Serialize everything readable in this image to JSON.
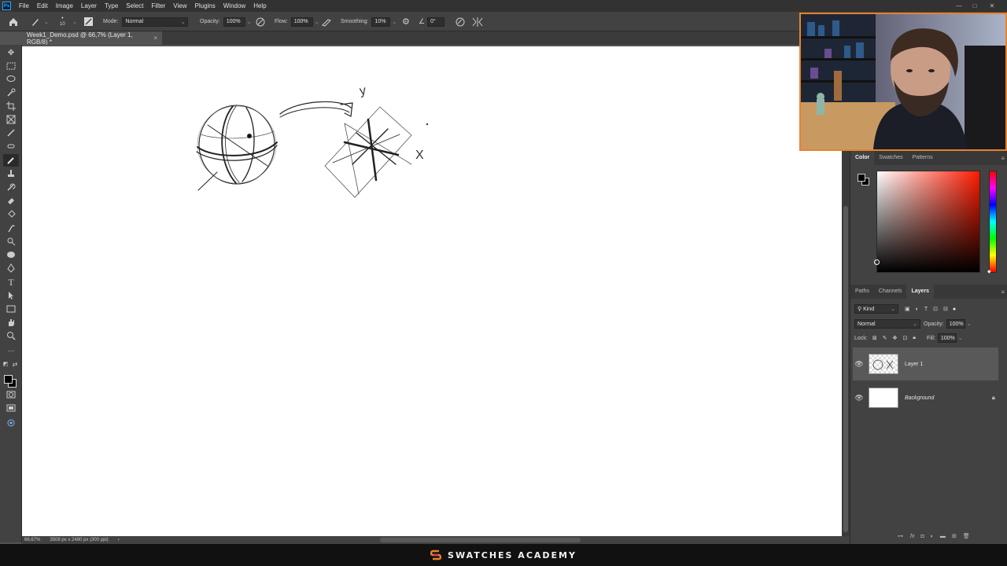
{
  "app": {
    "menu": [
      "File",
      "Edit",
      "Image",
      "Layer",
      "Type",
      "Select",
      "Filter",
      "View",
      "Plugins",
      "Window",
      "Help"
    ],
    "window_controls": [
      "—",
      "□",
      "✕"
    ]
  },
  "options_bar": {
    "brush_size": "10",
    "mode_label": "Mode:",
    "mode_value": "Normal",
    "opacity_label": "Opacity:",
    "opacity_value": "100%",
    "flow_label": "Flow:",
    "flow_value": "100%",
    "smoothing_label": "Smoothing:",
    "smoothing_value": "10%",
    "angle_value": "0°"
  },
  "document": {
    "tab_title": "Week1_Demo.psd @ 66,7% (Layer 1, RGB/8) *",
    "close": "×"
  },
  "canvas_sketch": {
    "label_y": "y",
    "label_x": "X"
  },
  "statusbar": {
    "zoom": "66,67%",
    "doc_info": "3508 px x 2480 px (300 ppi)",
    "arrow": "›"
  },
  "color_panel": {
    "tabs": [
      "Color",
      "Swatches",
      "Patterns"
    ],
    "active_tab": "Color",
    "picker_hue": "#ff1a00"
  },
  "layers_panel": {
    "tabs": [
      "Paths",
      "Channels",
      "Layers"
    ],
    "active_tab": "Layers",
    "kind_filter": "Kind",
    "blend_mode": "Normal",
    "opacity_label": "Opacity:",
    "opacity_value": "100%",
    "lock_label": "Lock:",
    "fill_label": "Fill:",
    "fill_value": "100%",
    "layers": [
      {
        "name": "Layer 1",
        "selected": true,
        "visible": true
      },
      {
        "name": "Background",
        "selected": false,
        "visible": true,
        "locked": true
      }
    ]
  },
  "footer": {
    "brand": "SWATCHES ACADEMY"
  },
  "colors": {
    "webcam_border": "#e8822b",
    "ps_blue": "#31a8ff",
    "panel_bg": "#424242"
  }
}
